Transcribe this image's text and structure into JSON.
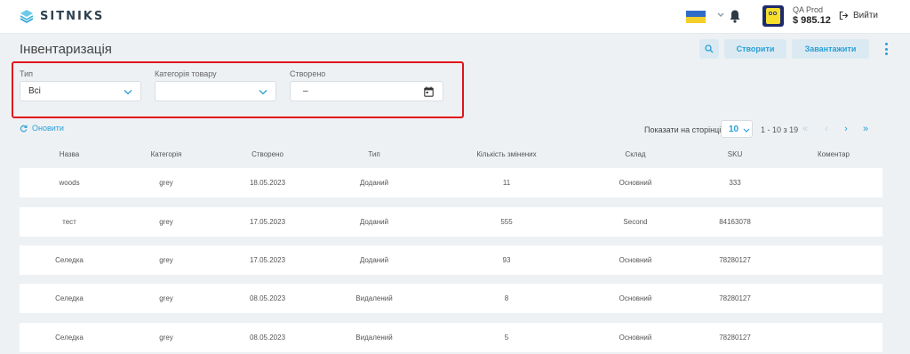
{
  "app": {
    "brand": "SITNIKS"
  },
  "account": {
    "name": "QA Prod",
    "balance": "$ 985.12",
    "logout_label": "Вийти"
  },
  "page": {
    "title": "Інвентаризація"
  },
  "actions": {
    "create_label": "Створити",
    "upload_label": "Завантажити"
  },
  "filters": {
    "type": {
      "label": "Тип",
      "value": "Всі"
    },
    "category": {
      "label": "Категорія товару",
      "value": ""
    },
    "created": {
      "label": "Створено",
      "value": "–"
    }
  },
  "toolbar": {
    "refresh_label": "Оновити",
    "per_page_label": "Показати на сторінці",
    "per_page_value": "10",
    "range_text": "1 - 10 з 19",
    "pager": {
      "first": "«",
      "prev": "‹",
      "next": "›",
      "last": "»"
    }
  },
  "table": {
    "columns": [
      "Назва",
      "Категорія",
      "Створено",
      "Тип",
      "Кількість змінених",
      "Склад",
      "SKU",
      "Коментар"
    ],
    "rows": [
      [
        "woods",
        "grey",
        "18.05.2023",
        "Доданий",
        "11",
        "Основний",
        "333",
        ""
      ],
      [
        "тест",
        "grey",
        "17.05.2023",
        "Доданий",
        "555",
        "Second",
        "84163078",
        ""
      ],
      [
        "Селедка",
        "grey",
        "17.05.2023",
        "Доданий",
        "93",
        "Основний",
        "78280127",
        ""
      ],
      [
        "Селедка",
        "grey",
        "08.05.2023",
        "Видалений",
        "8",
        "Основний",
        "78280127",
        ""
      ],
      [
        "Селедка",
        "grey",
        "08.05.2023",
        "Видалений",
        "5",
        "Основний",
        "78280127",
        ""
      ]
    ]
  },
  "colors": {
    "accent": "#2a9fd6",
    "highlight": "#e0141a",
    "button_bg": "#dbeaf2"
  },
  "icons": [
    "logo-icon",
    "ukraine-flag-icon",
    "chevron-down-icon",
    "bell-icon",
    "logout-icon",
    "search-icon",
    "more-vertical-icon",
    "calendar-icon",
    "refresh-icon"
  ]
}
